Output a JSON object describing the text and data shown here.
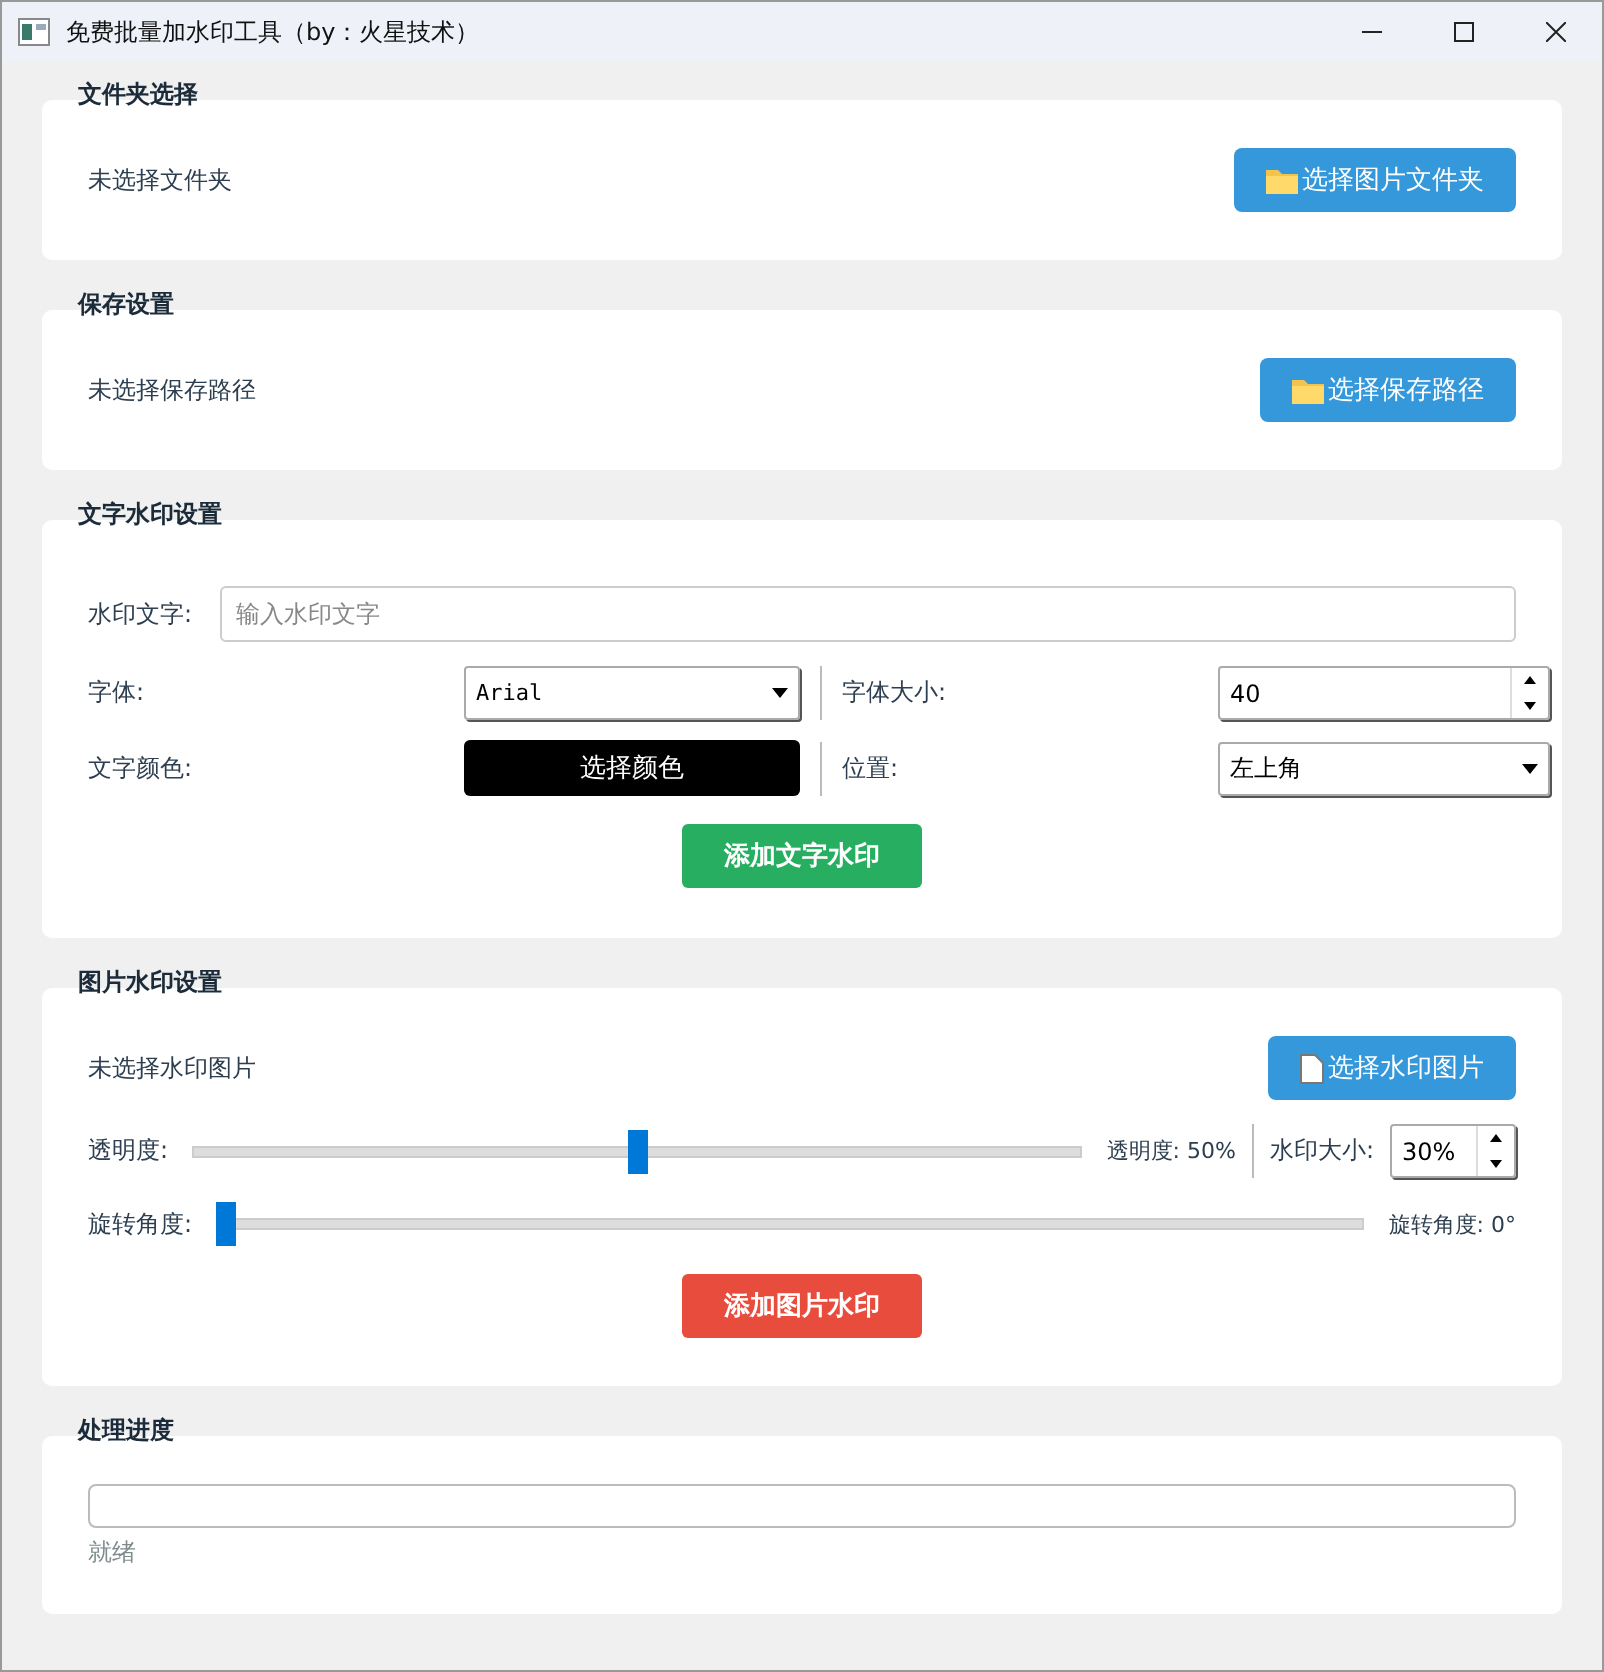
{
  "window": {
    "title": "免费批量加水印工具（by：火星技术）"
  },
  "folder": {
    "title": "文件夹选择",
    "status": "未选择文件夹",
    "button": "选择图片文件夹"
  },
  "save": {
    "title": "保存设置",
    "status": "未选择保存路径",
    "button": "选择保存路径"
  },
  "text_watermark": {
    "title": "文字水印设置",
    "text_label": "水印文字:",
    "text_placeholder": "输入水印文字",
    "font_label": "字体:",
    "font_value": "Arial",
    "size_label": "字体大小:",
    "size_value": "40",
    "color_label": "文字颜色:",
    "color_button": "选择颜色",
    "color": "#000000",
    "position_label": "位置:",
    "position_value": "左上角",
    "add_button": "添加文字水印"
  },
  "image_watermark": {
    "title": "图片水印设置",
    "status": "未选择水印图片",
    "button": "选择水印图片",
    "opacity_label": "透明度:",
    "opacity_slider": {
      "level": 0.5
    },
    "opacity_reading": "透明度: 50%",
    "scale_label": "水印大小:",
    "scale_value": "30%",
    "rotation_label": "旋转角度:",
    "rotation_slider": {
      "level": 0
    },
    "rotation_reading": "旋转角度: 0°",
    "add_button": "添加图片水印"
  },
  "progress": {
    "title": "处理进度",
    "level": 0,
    "status": "就绪"
  }
}
